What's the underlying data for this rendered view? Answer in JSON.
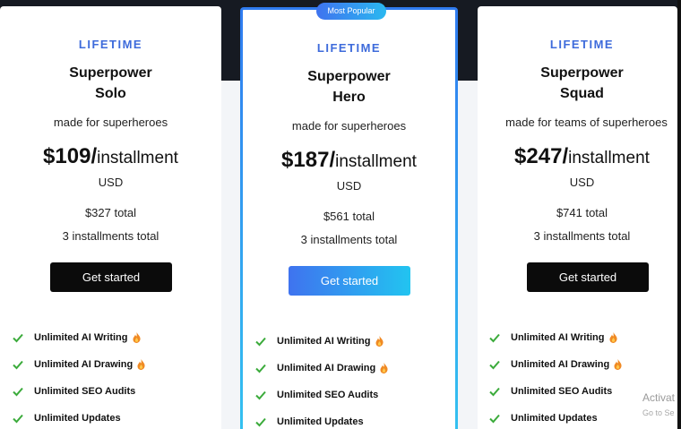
{
  "badge": "Most Popular",
  "check_icon_color": "#3bab3b",
  "accent_color": "#3e6bdb",
  "plans": [
    {
      "tier": "LIFETIME",
      "name_line1": "Superpower",
      "name_line2": "Solo",
      "tagline": "made for superheroes",
      "price": "$109",
      "price_slash": "/",
      "price_unit": "installment",
      "currency": "USD",
      "total": "$327 total",
      "installments": "3 installments total",
      "cta": "Get started",
      "features": [
        "Unlimited AI Writing",
        "Unlimited AI Drawing",
        "Unlimited SEO Audits",
        "Unlimited Updates"
      ]
    },
    {
      "tier": "LIFETIME",
      "name_line1": "Superpower",
      "name_line2": "Hero",
      "tagline": "made for superheroes",
      "price": "$187",
      "price_slash": "/",
      "price_unit": "installment",
      "currency": "USD",
      "total": "$561 total",
      "installments": "3 installments total",
      "cta": "Get started",
      "features": [
        "Unlimited AI Writing",
        "Unlimited AI Drawing",
        "Unlimited SEO Audits",
        "Unlimited Updates"
      ]
    },
    {
      "tier": "LIFETIME",
      "name_line1": "Superpower",
      "name_line2": "Squad",
      "tagline": "made for teams of superheroes",
      "price": "$247",
      "price_slash": "/",
      "price_unit": "installment",
      "currency": "USD",
      "total": "$741 total",
      "installments": "3 installments total",
      "cta": "Get started",
      "features": [
        "Unlimited AI Writing",
        "Unlimited AI Drawing",
        "Unlimited SEO Audits",
        "Unlimited Updates"
      ]
    }
  ],
  "watermark": {
    "line1": "Activat",
    "line2": "Go to Se"
  }
}
